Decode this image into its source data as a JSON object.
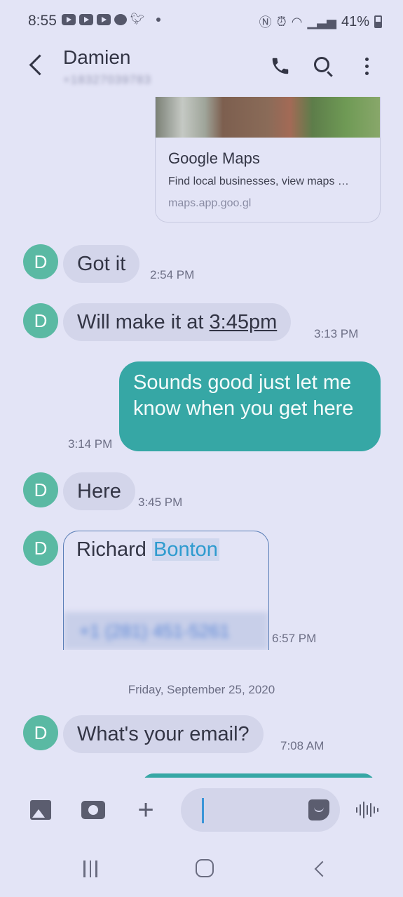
{
  "status_bar": {
    "time": "8:55",
    "notification_icons": [
      "youtube-icon",
      "youtube-icon",
      "youtube-icon",
      "chat-icon",
      "twitter-icon"
    ],
    "battery": "41%",
    "status_icons": [
      "nfc-icon",
      "alarm-icon",
      "wifi-icon",
      "signal-icon",
      "battery-icon"
    ]
  },
  "header": {
    "contact_name": "Damien",
    "contact_number": "+18327039783"
  },
  "link_preview": {
    "title": "Google Maps",
    "description": "Find local businesses, view maps …",
    "url": "maps.app.goo.gl"
  },
  "messages": [
    {
      "direction": "incoming",
      "avatar": "D",
      "text": "Got it",
      "time": "2:54 PM"
    },
    {
      "direction": "incoming",
      "avatar": "D",
      "text_prefix": "Will make it at ",
      "text_link": "3:45pm",
      "time": "3:13 PM"
    },
    {
      "direction": "outgoing",
      "text": "Sounds good just let me know when you get here",
      "time": "3:14 PM"
    },
    {
      "direction": "incoming",
      "avatar": "D",
      "text": "Here",
      "time": "3:45 PM"
    },
    {
      "direction": "incoming",
      "avatar": "D",
      "type": "contact",
      "first_name": "Richard",
      "last_name": "Bonton",
      "phone": "+1 (281) 451-5261",
      "time": "6:57 PM"
    },
    {
      "direction": "incoming",
      "avatar": "D",
      "text": "What's your email?",
      "time": "7:08 AM"
    }
  ],
  "date_separator": "Friday, September 25, 2020",
  "composer": {
    "icons": [
      "gallery-icon",
      "camera-icon",
      "plus-icon",
      "sticker-icon",
      "voice-icon"
    ]
  },
  "colors": {
    "background": "#e3e4f6",
    "incoming_bubble": "#d3d5ea",
    "outgoing_bubble": "#36a7a5",
    "avatar": "#5ab9a3",
    "highlight_link": "#2e9bcf"
  }
}
